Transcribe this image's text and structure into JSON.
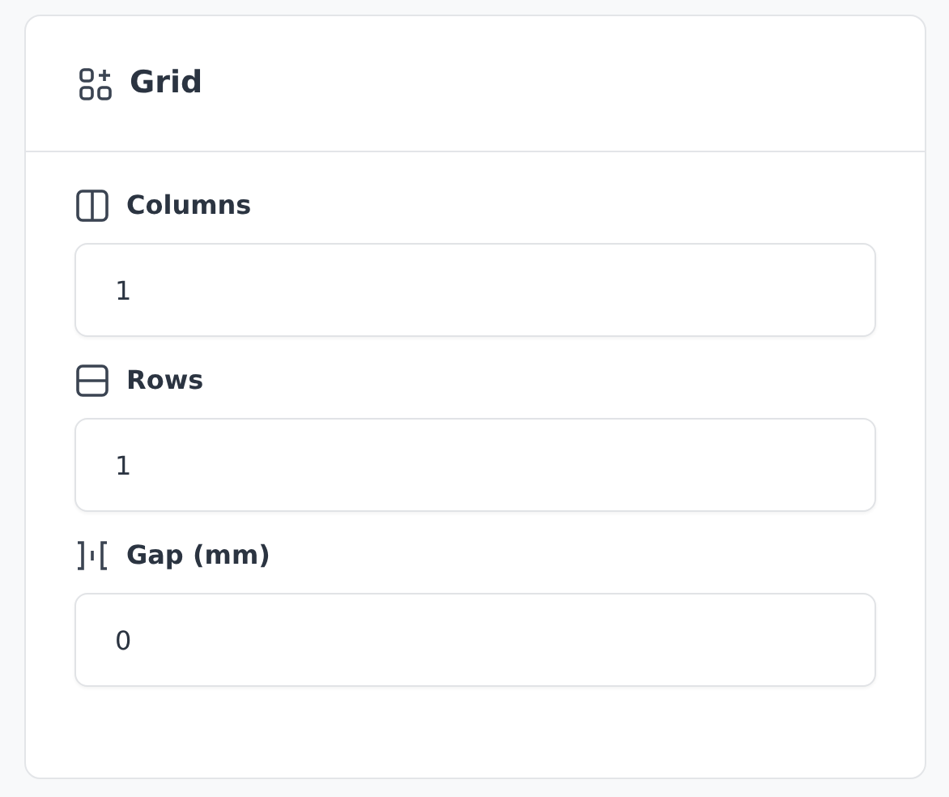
{
  "panel": {
    "title": "Grid"
  },
  "fields": [
    {
      "kind": "columns",
      "label": "Columns",
      "value": "1"
    },
    {
      "kind": "rows",
      "label": "Rows",
      "value": "1"
    },
    {
      "kind": "gap",
      "label": "Gap (mm)",
      "value": "0"
    }
  ]
}
